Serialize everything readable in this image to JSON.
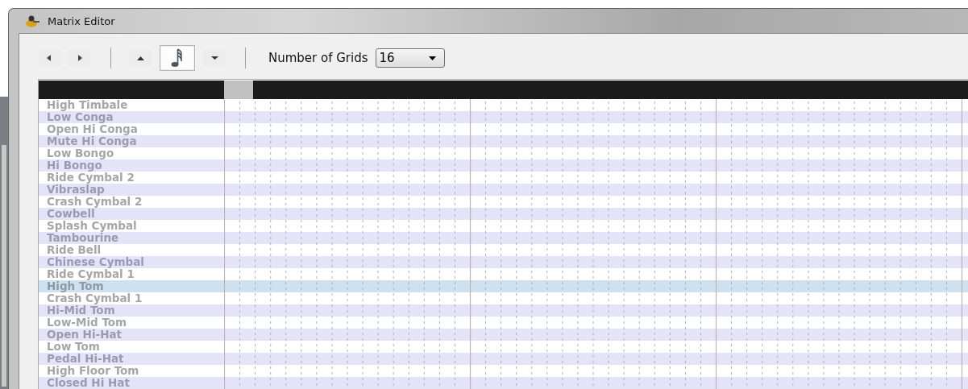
{
  "window": {
    "title": "Matrix Editor"
  },
  "toolbar": {
    "buttons": [
      {
        "kind": "previous",
        "selected": false
      },
      {
        "kind": "next",
        "selected": false
      },
      {
        "kind": "separator"
      },
      {
        "kind": "up",
        "selected": false
      },
      {
        "kind": "note",
        "selected": true
      },
      {
        "kind": "down",
        "selected": false
      },
      {
        "kind": "separator"
      }
    ],
    "grids": {
      "label": "Number of Grids",
      "value": "16"
    }
  },
  "instruments": [
    {
      "name": "High Timbale",
      "selected": false
    },
    {
      "name": "Low Conga",
      "selected": false
    },
    {
      "name": "Open Hi Conga",
      "selected": false
    },
    {
      "name": "Mute Hi Conga",
      "selected": false
    },
    {
      "name": "Low Bongo",
      "selected": false
    },
    {
      "name": "Hi Bongo",
      "selected": false
    },
    {
      "name": "Ride Cymbal 2",
      "selected": false
    },
    {
      "name": "Vibraslap",
      "selected": false
    },
    {
      "name": "Crash Cymbal 2",
      "selected": false
    },
    {
      "name": "Cowbell",
      "selected": false
    },
    {
      "name": "Splash Cymbal",
      "selected": false
    },
    {
      "name": "Tambourine",
      "selected": false
    },
    {
      "name": "Ride Bell",
      "selected": false
    },
    {
      "name": "Chinese Cymbal",
      "selected": false
    },
    {
      "name": "Ride Cymbal 1",
      "selected": false
    },
    {
      "name": "High Tom",
      "selected": true
    },
    {
      "name": "Crash Cymbal 1",
      "selected": false
    },
    {
      "name": "Hi-Mid Tom",
      "selected": false
    },
    {
      "name": "Low-Mid Tom",
      "selected": false
    },
    {
      "name": "Open Hi-Hat",
      "selected": false
    },
    {
      "name": "Low Tom",
      "selected": false
    },
    {
      "name": "Pedal Hi-Hat",
      "selected": false
    },
    {
      "name": "High Floor Tom",
      "selected": false
    },
    {
      "name": "Closed Hi Hat",
      "selected": false
    }
  ]
}
